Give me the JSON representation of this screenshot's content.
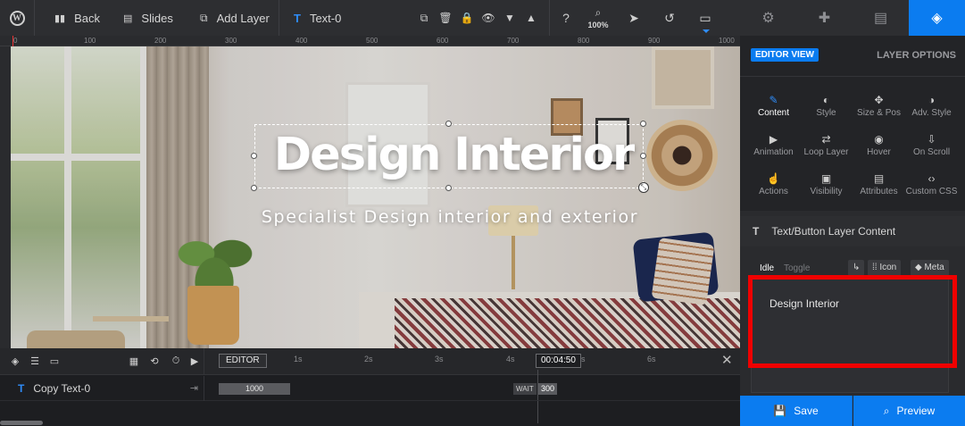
{
  "toolbar": {
    "wp_logo": "W",
    "back": "Back",
    "slides": "Slides",
    "add_layer": "Add Layer",
    "layer_name": "Text-0",
    "zoom": "100%",
    "icons": [
      "duplicate-icon",
      "trash-icon",
      "lock-icon",
      "eye-icon",
      "chevron-down-icon",
      "chevron-up-icon",
      "help-icon",
      "zoom-icon",
      "cursor-icon",
      "undo-icon",
      "monitor-icon"
    ]
  },
  "ruler": {
    "labels": [
      "0",
      "100",
      "200",
      "300",
      "400",
      "500",
      "600",
      "700",
      "800",
      "900",
      "1000"
    ]
  },
  "canvas": {
    "headline": "Design Interior",
    "subline": "Specialist Design interior and exterior"
  },
  "timeline": {
    "editor_btn": "EDITOR",
    "seconds": [
      "1s",
      "2s",
      "3s",
      "4s",
      "5s",
      "6s"
    ],
    "time": "00:04:50",
    "row_label": "Copy Text-0",
    "bar_value": "1000",
    "wait_label": "WAIT",
    "wait_value": "300"
  },
  "panel": {
    "tabs": [
      "gear-icon",
      "puzzle-icon",
      "slides-icon",
      "layers-icon"
    ],
    "editor_view": "EDITOR VIEW",
    "layer_options": "LAYER OPTIONS",
    "grid": [
      {
        "label": "Content",
        "icon": "✎"
      },
      {
        "label": "Style",
        "icon": "◐"
      },
      {
        "label": "Size & Pos",
        "icon": "✥"
      },
      {
        "label": "Adv. Style",
        "icon": "◑"
      },
      {
        "label": "Animation",
        "icon": "▶"
      },
      {
        "label": "Loop Layer",
        "icon": "⇄"
      },
      {
        "label": "Hover",
        "icon": "◉"
      },
      {
        "label": "On Scroll",
        "icon": "⇩"
      },
      {
        "label": "Actions",
        "icon": "☝"
      },
      {
        "label": "Visibility",
        "icon": "▣"
      },
      {
        "label": "Attributes",
        "icon": "▤"
      },
      {
        "label": "Custom CSS",
        "icon": "‹›"
      }
    ],
    "section_title": "Text/Button Layer Content",
    "idle": "Idle",
    "toggle": "Toggle",
    "icon_btn": "Icon",
    "meta_btn": "Meta",
    "text_value": "Design Interior",
    "save": "Save",
    "preview": "Preview"
  },
  "colors": {
    "accent": "#0b7cf0",
    "highlight": "#f00000"
  }
}
